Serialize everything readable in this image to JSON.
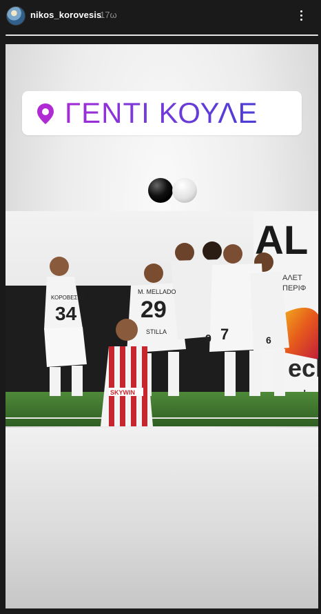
{
  "header": {
    "username": "nikos_korovesis",
    "time": "17ω",
    "avatar_icon": "profile-avatar",
    "more_icon": "more-options-icon"
  },
  "progress": {
    "value": 1.0
  },
  "story": {
    "location_sticker": {
      "icon": "location-pin-icon",
      "text": "ΓΕΝΤΙ ΚΟΥΛΕ",
      "pin_color": "#b12bd4",
      "text_gradient": [
        "#a52ad6",
        "#4b3dd6"
      ]
    },
    "emoji": "black-white-circles-emoji",
    "photo": {
      "description_icon": "team-celebration-photo",
      "jersey_names": [
        "ΚΟΡΟΒΕΣΗΣ",
        "M. MELLADO"
      ],
      "jersey_numbers": [
        "34",
        "29",
        "9",
        "7",
        "6"
      ],
      "sponsor": "STILLA",
      "opponent_sponsor": "SKYWIN",
      "board_text_1": "AL",
      "board_text_2": "ΑΛΕΤ",
      "board_text_3": "ΠΕΡΙΦ",
      "board_text_4": "ech",
      "board_text_5": "le"
    }
  }
}
